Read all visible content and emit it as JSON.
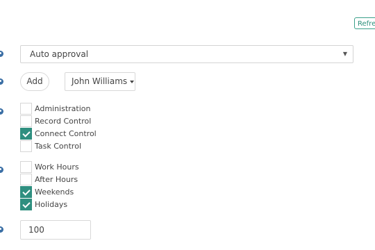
{
  "header": {
    "refresh_label": "Refresh"
  },
  "approval": {
    "selected": "Auto approval"
  },
  "actions": {
    "add_label": "Add",
    "user_selected": "John Williams"
  },
  "permissions": {
    "items": [
      {
        "label": "Administration",
        "checked": false
      },
      {
        "label": "Record Control",
        "checked": false
      },
      {
        "label": "Connect Control",
        "checked": true
      },
      {
        "label": "Task Control",
        "checked": false
      }
    ]
  },
  "schedule": {
    "items": [
      {
        "label": "Work Hours",
        "checked": false
      },
      {
        "label": "After Hours",
        "checked": false
      },
      {
        "label": "Weekends",
        "checked": true
      },
      {
        "label": "Holidays",
        "checked": true
      }
    ]
  },
  "limit": {
    "value": "100"
  },
  "colors": {
    "accent": "#2f8f80",
    "help_icon": "#3b6fa5"
  },
  "icons": {
    "help": "question-circle-icon",
    "check": "checkmark-icon",
    "caret": "caret-down-icon"
  }
}
